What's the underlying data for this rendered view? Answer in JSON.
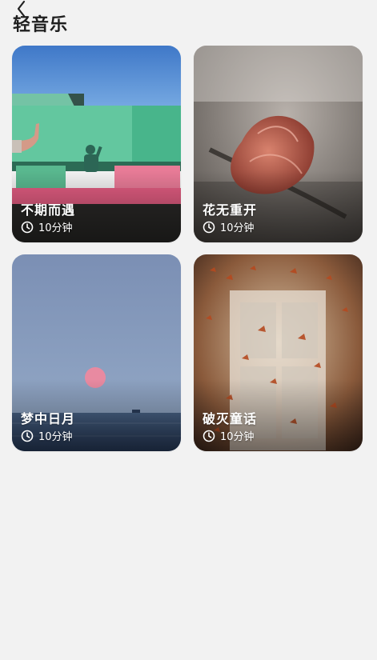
{
  "header": {
    "title": "轻音乐",
    "back_icon": "chevron-left-icon"
  },
  "cards": [
    {
      "title": "不期而遇",
      "duration": "10分钟",
      "clock_icon": "clock-icon"
    },
    {
      "title": "花无重开",
      "duration": "10分钟",
      "clock_icon": "clock-icon"
    },
    {
      "title": "梦中日月",
      "duration": "10分钟",
      "clock_icon": "clock-icon"
    },
    {
      "title": "破灭童话",
      "duration": "10分钟",
      "clock_icon": "clock-icon"
    }
  ],
  "colors": {
    "background": "#f2f2f2",
    "title_text": "#1f1f1f",
    "card_text": "#ffffff"
  }
}
